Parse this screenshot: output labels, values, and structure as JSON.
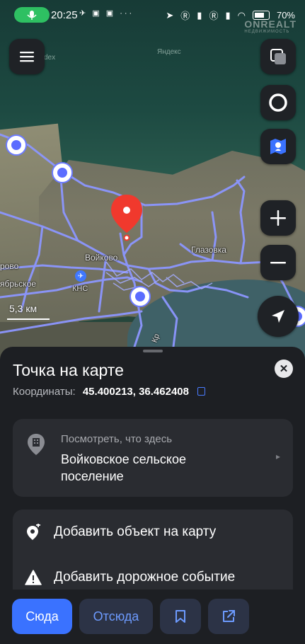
{
  "status_bar": {
    "time": "20:25",
    "battery": "70%",
    "more": "···"
  },
  "map": {
    "watermarks": [
      "Яндекс",
      "dex"
    ],
    "brand_overlay": {
      "name": "ONREALT",
      "tagline": "НЕДВИЖИМОСТЬ"
    },
    "labels": {
      "voykovo": "Войково",
      "glazovka": "Глазовка",
      "kns": "КНС",
      "left_edge_1": "рово",
      "left_edge_2": "ябрьское",
      "bottom_edge": "Кр"
    },
    "scale": "5,3 км",
    "icons": [
      "menu-icon",
      "layers-icon",
      "alice-icon",
      "routes-icon",
      "zoom-in-icon",
      "zoom-out-icon",
      "locate-icon",
      "selected-point-pin"
    ]
  },
  "sheet": {
    "title": "Точка на карте",
    "coords_label": "Координаты:",
    "coords_value": "45.400213, 36.462408",
    "whats_here": {
      "hint": "Посмотреть, что здесь",
      "place": "Войковское сельское поселение"
    },
    "actions": [
      {
        "label": "Добавить объект на карту",
        "icon": "add-place-icon"
      },
      {
        "label": "Добавить дорожное событие",
        "icon": "warning-icon"
      }
    ]
  },
  "bottom_bar": {
    "here": "Сюда",
    "from": "Отсюда",
    "save_icon": "bookmark-icon",
    "share_icon": "share-icon"
  },
  "colors": {
    "accent": "#3a72ff",
    "pin": "#f0392d",
    "route": "#7b86ff"
  }
}
